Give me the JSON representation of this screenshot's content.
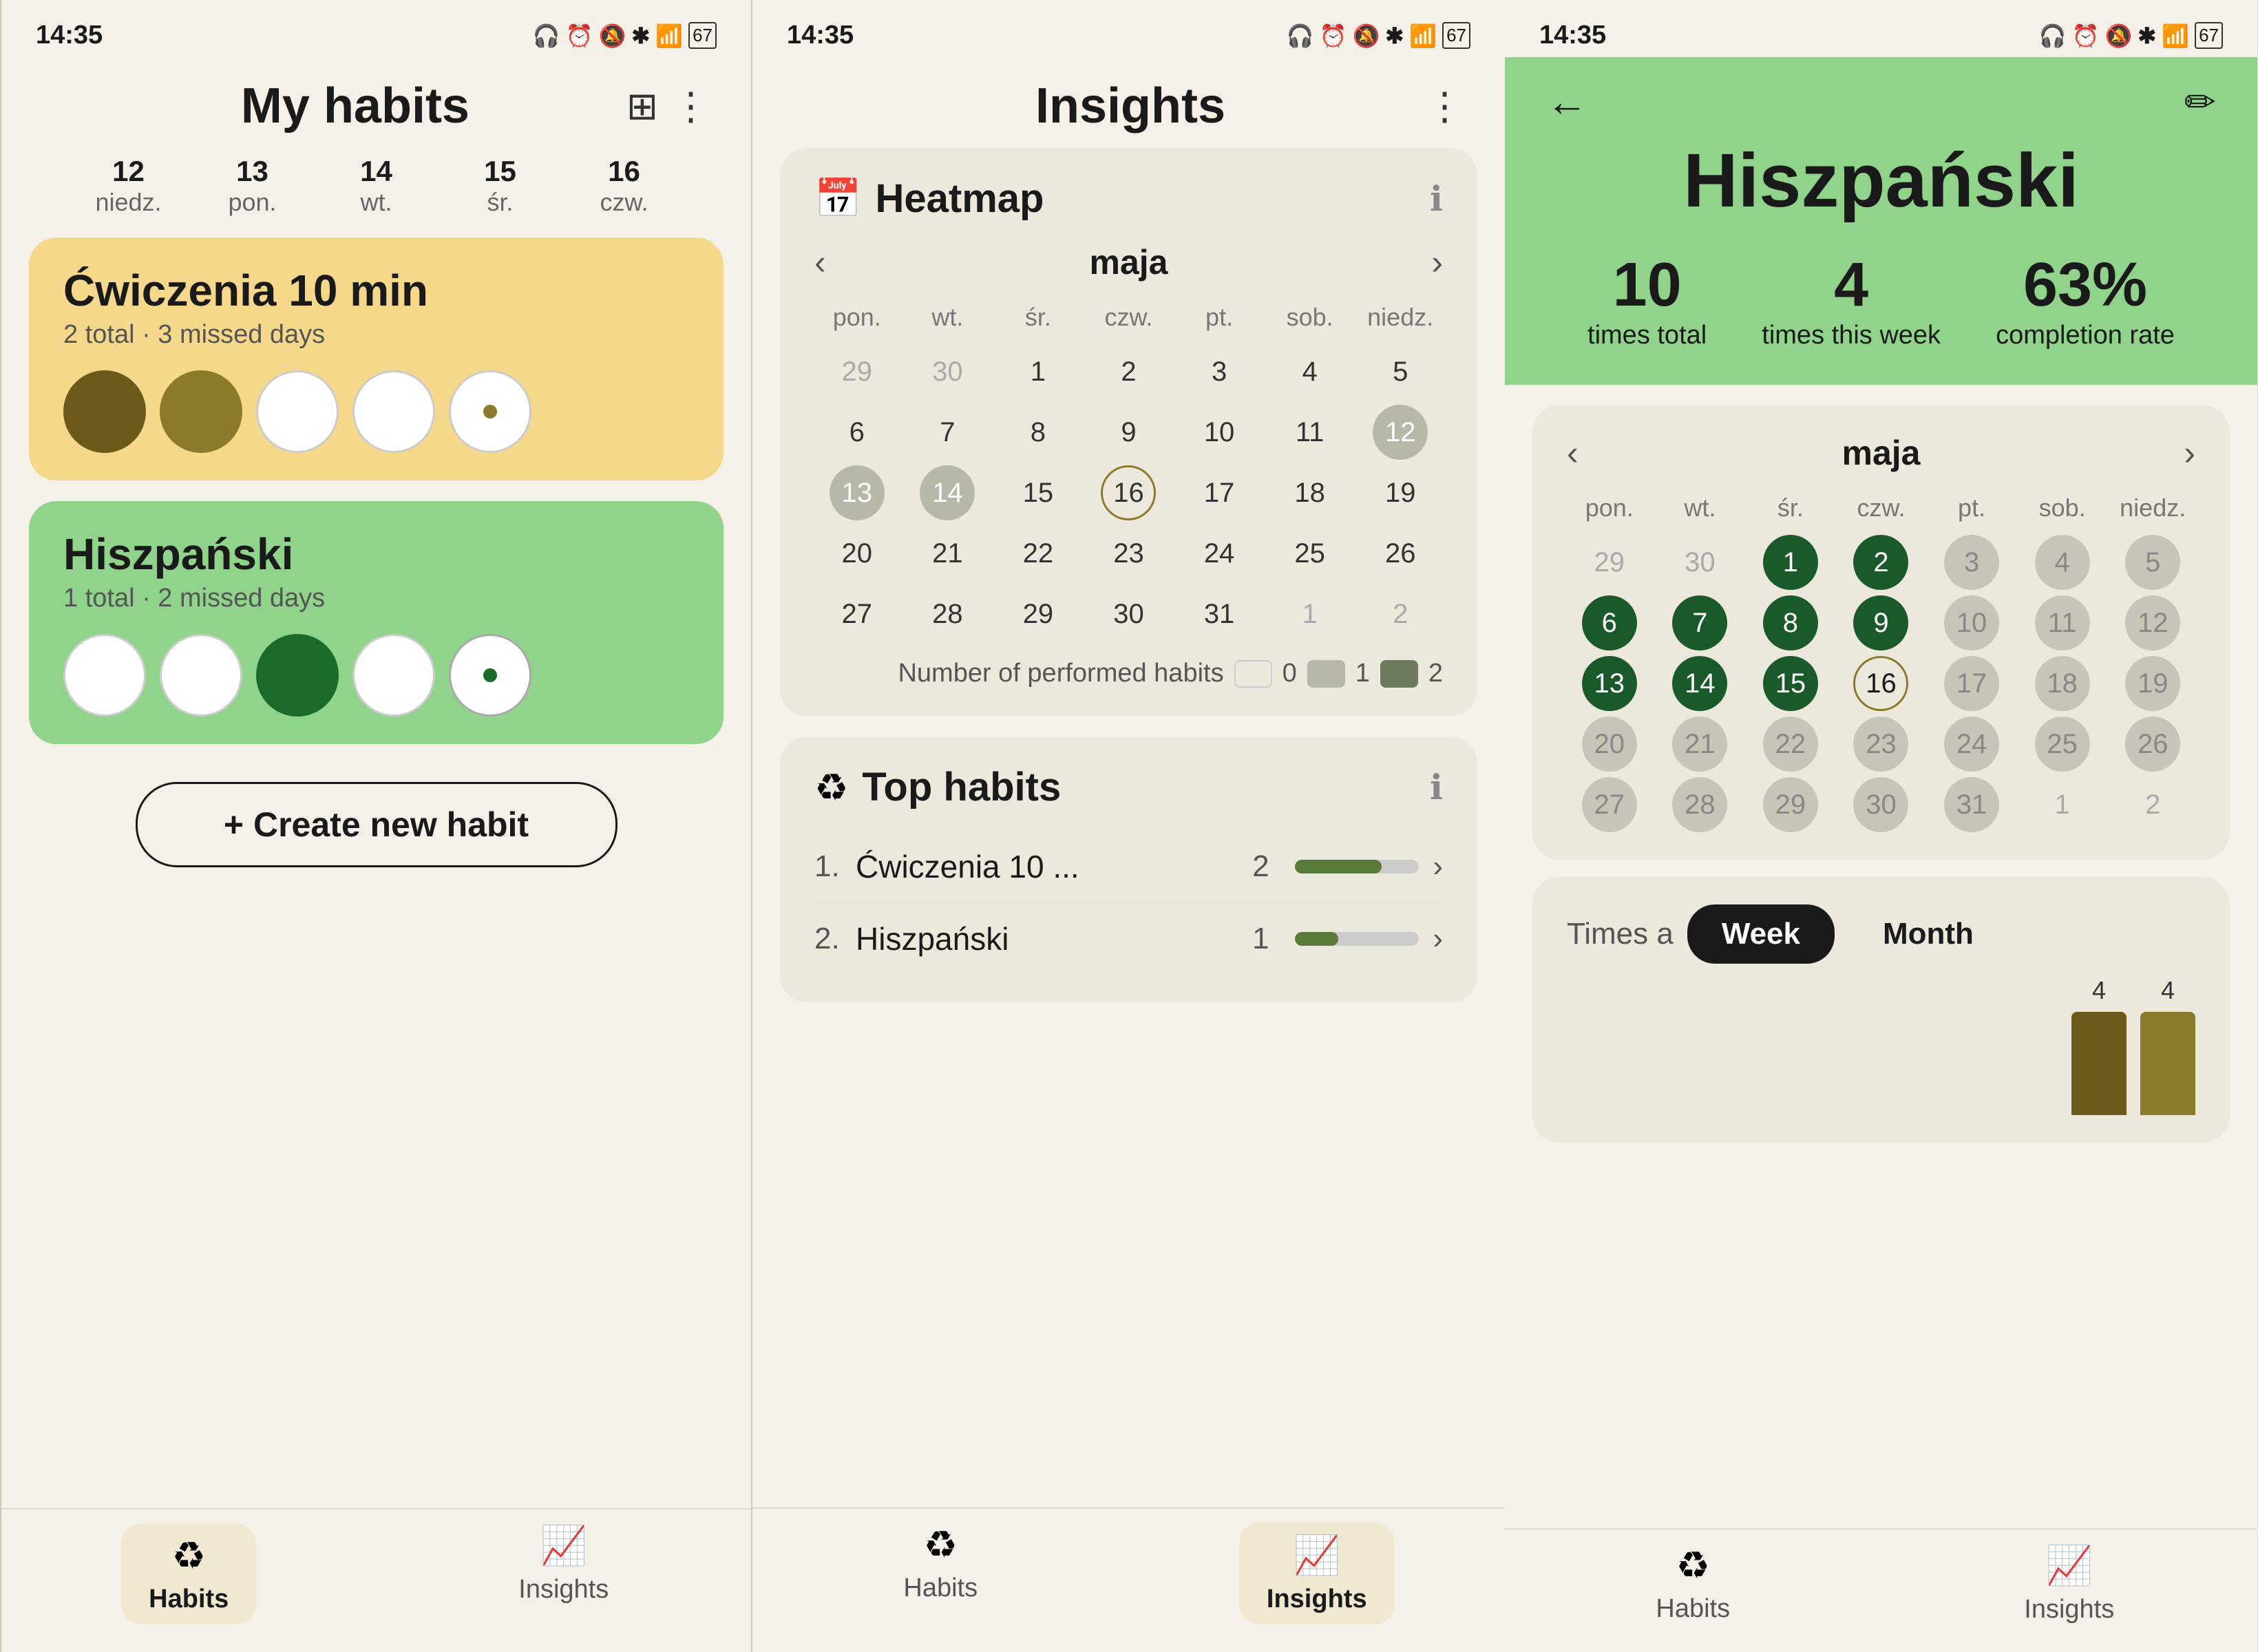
{
  "panel1": {
    "status_time": "14:35",
    "title": "My habits",
    "days": [
      {
        "num": "12",
        "label": "niedz."
      },
      {
        "num": "13",
        "label": "pon."
      },
      {
        "num": "14",
        "label": "wt."
      },
      {
        "num": "15",
        "label": "śr."
      },
      {
        "num": "16",
        "label": "czw."
      }
    ],
    "habit1": {
      "name": "Ćwiczenia 10 min",
      "subtitle": "2 total · 3 missed days",
      "color": "orange"
    },
    "habit2": {
      "name": "Hiszpański",
      "subtitle": "1 total · 2 missed days",
      "color": "green"
    },
    "create_btn": "+ Create new habit",
    "nav": {
      "habits": "Habits",
      "insights": "Insights"
    }
  },
  "panel2": {
    "status_time": "14:35",
    "title": "Insights",
    "heatmap": {
      "title": "Heatmap",
      "month": "maja",
      "days_header": [
        "pon.",
        "wt.",
        "śr.",
        "czw.",
        "pt.",
        "sob.",
        "niedz."
      ],
      "legend_label": "Number of performed habits",
      "legend_values": [
        "0",
        "1",
        "2"
      ]
    },
    "top_habits": {
      "title": "Top habits",
      "items": [
        {
          "rank": "1.",
          "name": "Ćwiczenia 10 ...",
          "count": "2"
        },
        {
          "rank": "2.",
          "name": "Hiszpański",
          "count": "1"
        }
      ]
    },
    "nav": {
      "habits": "Habits",
      "insights": "Insights"
    }
  },
  "panel3": {
    "status_time": "14:35",
    "title": "Hiszpański",
    "stats": {
      "times_total": "10",
      "times_total_label": "times total",
      "times_week": "4",
      "times_week_label": "times this week",
      "completion": "63%",
      "completion_label": "completion rate"
    },
    "calendar": {
      "month": "maja",
      "days_header": [
        "pon.",
        "wt.",
        "śr.",
        "czw.",
        "pt.",
        "sob.",
        "niedz."
      ]
    },
    "toggle": {
      "label": "Times a",
      "week": "Week",
      "month": "Month"
    },
    "chart": {
      "bar1_label": "4",
      "bar2_label": "4"
    },
    "nav": {
      "habits": "Habits",
      "insights": "Insights"
    }
  }
}
